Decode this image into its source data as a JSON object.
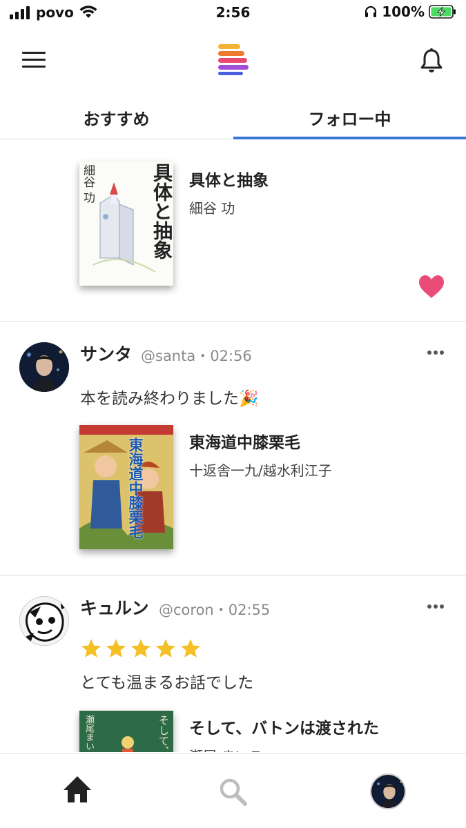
{
  "status_bar": {
    "carrier": "povo",
    "time": "2:56",
    "battery": "100%"
  },
  "tabs": {
    "recommended": "おすすめ",
    "following": "フォロー中",
    "active": "following"
  },
  "colors": {
    "accent": "#3a78d8",
    "heart": "#ea4c7a",
    "star": "#f5c026"
  },
  "feed": {
    "items": [
      {
        "book": {
          "title": "具体と抽象",
          "author": "細谷 功",
          "cover_text": "具体と抽象",
          "cover_author": "細谷 功"
        },
        "liked": true
      },
      {
        "user": {
          "name": "サンタ",
          "meta": "@santa・02:56"
        },
        "text": "本を読み終わりました🎉",
        "book": {
          "title": "東海道中膝栗毛",
          "author": "十返舎一九/越水利江子",
          "cover_text": "東海道中膝栗毛"
        }
      },
      {
        "user": {
          "name": "キュルン",
          "meta": "@coron・02:55"
        },
        "rating": 5,
        "text": "とても温まるお話でした",
        "book": {
          "title": "そして、バトンは渡された",
          "author": "瀬尾 まいこ",
          "cover_text": "そして、バトン",
          "cover_author": "瀬尾まいこ"
        }
      }
    ]
  },
  "icons": {
    "menu": "hamburger-menu-icon",
    "bell": "bell-icon",
    "heart": "heart-icon",
    "more": "ellipsis-icon",
    "home": "home-icon",
    "search": "search-icon"
  }
}
